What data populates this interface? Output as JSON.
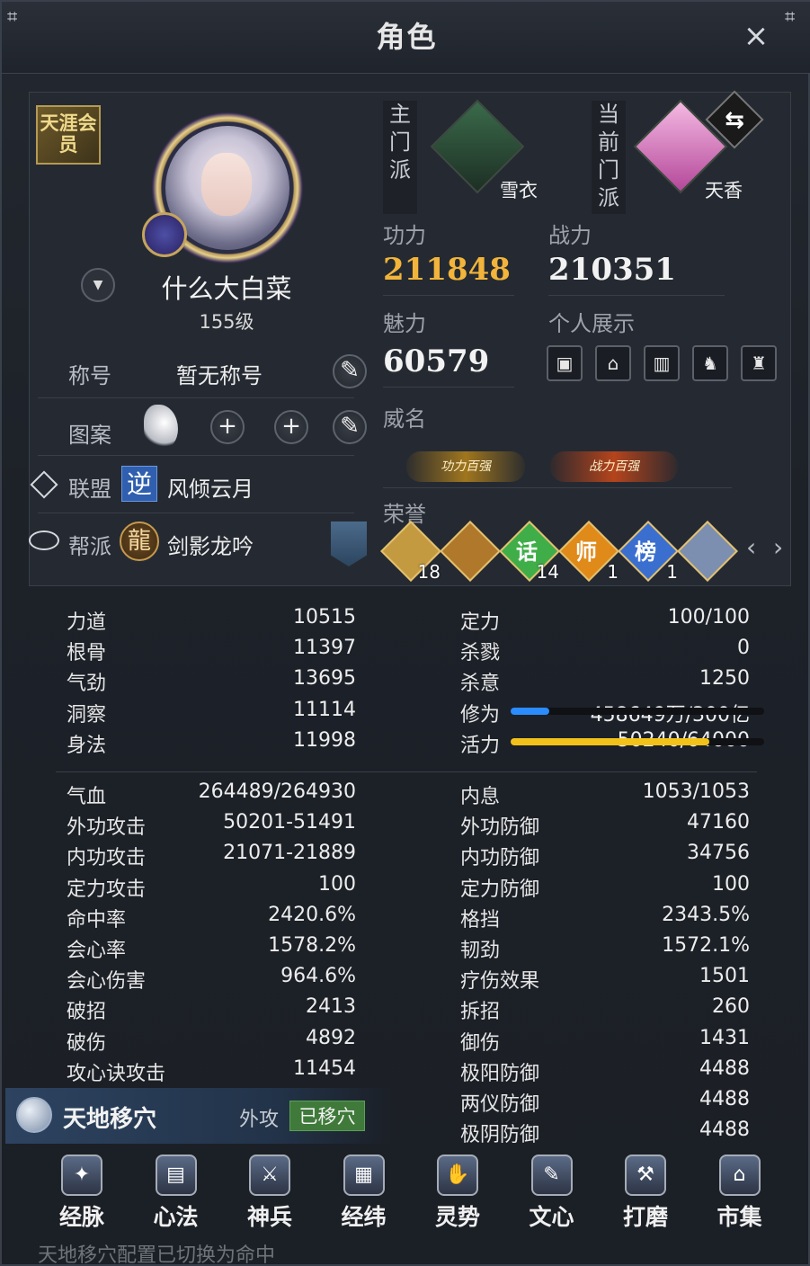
{
  "window": {
    "title": "角色",
    "close_icon": "×"
  },
  "profile": {
    "vip_label": "天涯会员",
    "name": "什么大白菜",
    "level": "155级"
  },
  "title_row": {
    "label": "称号",
    "value": "暂无称号"
  },
  "pattern_row": {
    "label": "图案",
    "add1": "+",
    "add2": "+"
  },
  "union_row": {
    "label": "联盟",
    "badge": "逆",
    "value": "风倾云月"
  },
  "guild_row": {
    "label": "帮派",
    "badge": "龍",
    "value": "剑影龙吟"
  },
  "sects": {
    "main_label": "主门派",
    "main_name": "雪衣",
    "current_label": "当前门派",
    "current_name": "天香",
    "swap_icon": "⇆"
  },
  "stats": {
    "gongli_label": "功力",
    "gongli": "211848",
    "zhanli_label": "战力",
    "zhanli": "210351",
    "meili_label": "魅力",
    "meili": "60579",
    "showcase_label": "个人展示",
    "weiming_label": "威名",
    "fame1": "功力百强",
    "fame2": "战力百强",
    "honor_label": "荣誉"
  },
  "honors": [
    {
      "text": "",
      "count": "18",
      "color": "#c49a40"
    },
    {
      "text": "",
      "count": "",
      "color": "#b0782a"
    },
    {
      "text": "话",
      "count": "14",
      "color": "#3fae48"
    },
    {
      "text": "师",
      "count": "1",
      "color": "#e08a1a"
    },
    {
      "text": "榜",
      "count": "1",
      "color": "#3a6fd0"
    },
    {
      "text": "",
      "count": "",
      "color": "#7c8fb0"
    }
  ],
  "pager": {
    "prev": "‹",
    "next": "›"
  },
  "attrs_left_top": [
    {
      "k": "力道",
      "v": "10515"
    },
    {
      "k": "根骨",
      "v": "11397"
    },
    {
      "k": "气劲",
      "v": "13695"
    },
    {
      "k": "洞察",
      "v": "11114"
    },
    {
      "k": "身法",
      "v": "11998"
    }
  ],
  "attrs_right_top": [
    {
      "k": "定力",
      "v": "100/100"
    },
    {
      "k": "杀戮",
      "v": "0"
    },
    {
      "k": "杀意",
      "v": "1250"
    },
    {
      "k": "修为",
      "v": "458649万/300亿"
    },
    {
      "k": "活力",
      "v": "50240/64000"
    }
  ],
  "bars": {
    "xiuwei_fraction": 0.153,
    "huoli_fraction": 0.785,
    "xiuwei_color": "#2a8cff",
    "huoli_color": "#f2c21a"
  },
  "attrs_left": [
    {
      "k": "气血",
      "v": "264489/264930"
    },
    {
      "k": "外功攻击",
      "v": "50201-51491"
    },
    {
      "k": "内功攻击",
      "v": "21071-21889"
    },
    {
      "k": "定力攻击",
      "v": "100"
    },
    {
      "k": "命中率",
      "v": "2420.6%"
    },
    {
      "k": "会心率",
      "v": "1578.2%"
    },
    {
      "k": "会心伤害",
      "v": "964.6%"
    },
    {
      "k": "破招",
      "v": "2413"
    },
    {
      "k": "破伤",
      "v": "4892"
    },
    {
      "k": "攻心诀攻击",
      "v": "11454"
    }
  ],
  "attrs_right": [
    {
      "k": "内息",
      "v": "1053/1053"
    },
    {
      "k": "外功防御",
      "v": "47160"
    },
    {
      "k": "内功防御",
      "v": "34756"
    },
    {
      "k": "定力防御",
      "v": "100"
    },
    {
      "k": "格挡",
      "v": "2343.5%"
    },
    {
      "k": "韧劲",
      "v": "1572.1%"
    },
    {
      "k": "疗伤效果",
      "v": "1501"
    },
    {
      "k": "拆招",
      "v": "260"
    },
    {
      "k": "御伤",
      "v": "1431"
    },
    {
      "k": "极阳防御",
      "v": "4488"
    },
    {
      "k": "两仪防御",
      "v": "4488"
    },
    {
      "k": "极阴防御",
      "v": "4488"
    }
  ],
  "skill": {
    "name": "天地移穴",
    "type": "外攻",
    "status": "已移穴"
  },
  "nav": [
    {
      "label": "经脉",
      "icon": "✦"
    },
    {
      "label": "心法",
      "icon": "▤"
    },
    {
      "label": "神兵",
      "icon": "⚔"
    },
    {
      "label": "经纬",
      "icon": "▦"
    },
    {
      "label": "灵势",
      "icon": "✋"
    },
    {
      "label": "文心",
      "icon": "✎"
    },
    {
      "label": "打磨",
      "icon": "⚒"
    },
    {
      "label": "市集",
      "icon": "⌂"
    }
  ],
  "bottom_message": "天地移穴配置已切换为命中"
}
